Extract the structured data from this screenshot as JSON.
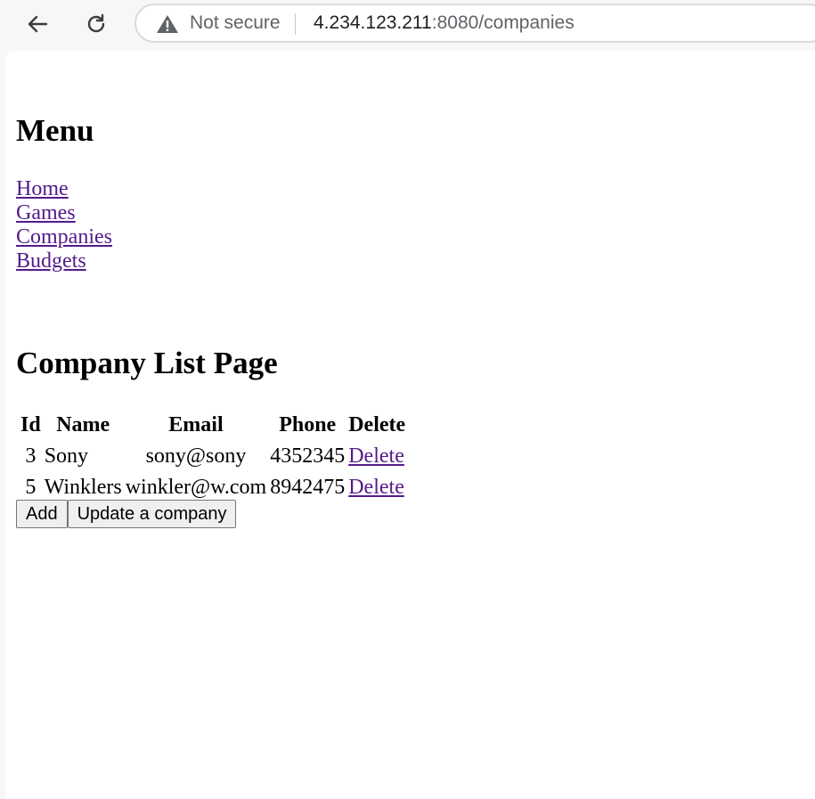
{
  "browser": {
    "security_label": "Not secure",
    "url_host": "4.234.123.211",
    "url_rest": ":8080/companies"
  },
  "menu": {
    "title": "Menu",
    "links": [
      "Home",
      "Games",
      "Companies",
      "Budgets"
    ]
  },
  "company_list": {
    "title": "Company List Page",
    "columns": [
      "Id",
      "Name",
      "Email",
      "Phone",
      "Delete"
    ],
    "rows": [
      {
        "id": "3",
        "name": "Sony",
        "email": "sony@sony",
        "phone": "4352345",
        "delete": "Delete"
      },
      {
        "id": "5",
        "name": "Winklers",
        "email": "winkler@w.com",
        "phone": "8942475",
        "delete": "Delete"
      }
    ]
  },
  "buttons": {
    "add": "Add",
    "update": "Update a company"
  }
}
